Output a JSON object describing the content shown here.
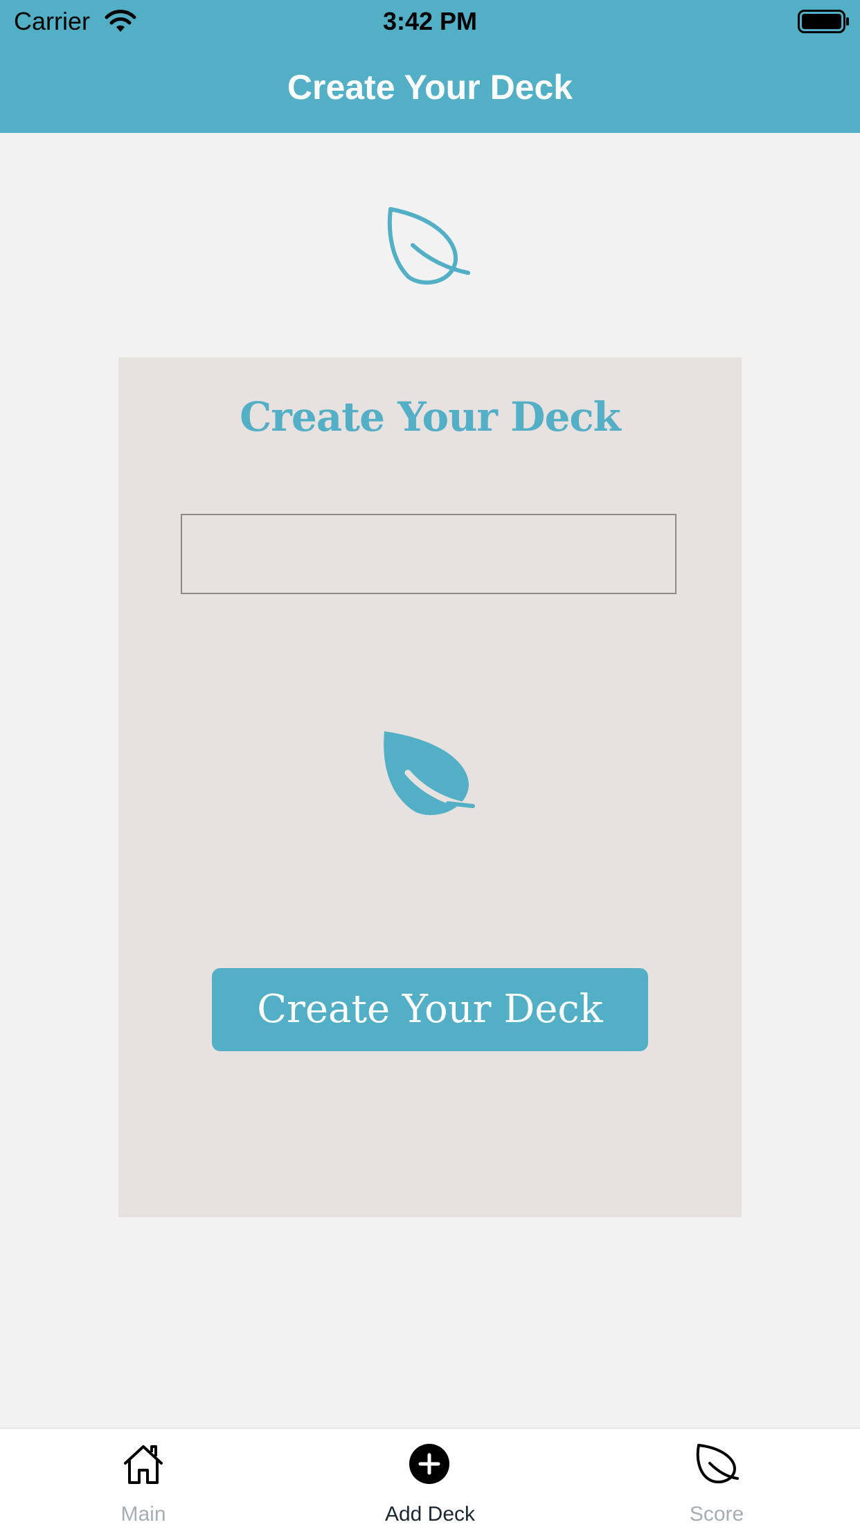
{
  "status_bar": {
    "carrier": "Carrier",
    "time": "3:42 PM"
  },
  "header": {
    "title": "Create Your Deck"
  },
  "card": {
    "title": "Create Your Deck",
    "input": {
      "value": "",
      "placeholder": ""
    },
    "button_label": "Create Your Deck"
  },
  "tab_bar": {
    "items": [
      {
        "label": "Main",
        "icon": "home-icon",
        "active": false
      },
      {
        "label": "Add Deck",
        "icon": "add-circle-icon",
        "active": true
      },
      {
        "label": "Score",
        "icon": "leaf-icon",
        "active": false
      }
    ]
  },
  "colors": {
    "accent": "#52afc6",
    "card_background": "#e7e2e0",
    "page_background": "#f2f2f2",
    "tab_active": "#1b2733",
    "tab_inactive": "#a7adb5"
  }
}
